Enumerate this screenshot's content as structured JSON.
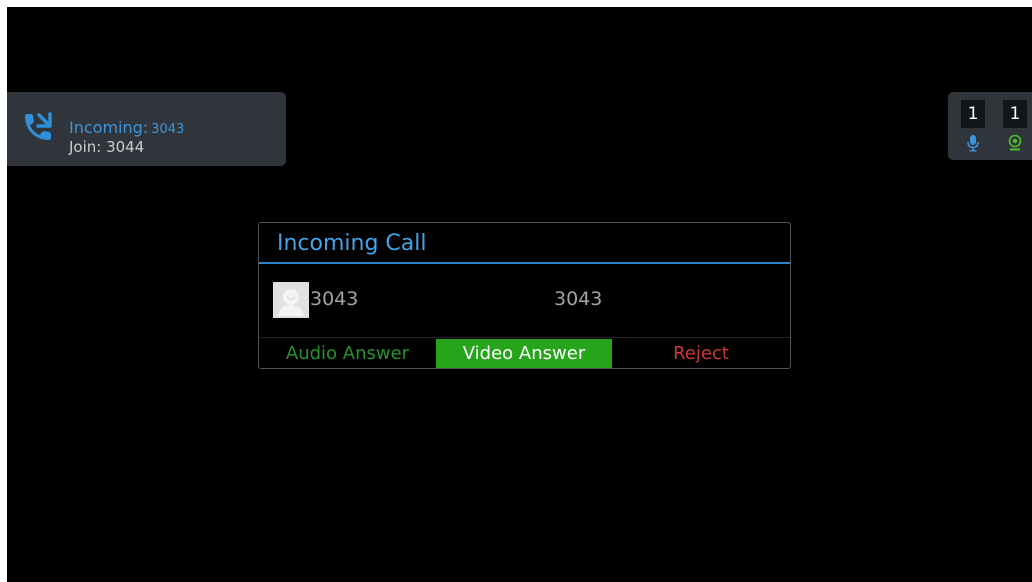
{
  "notification": {
    "icon": "incoming-call-icon",
    "incoming_label": "Incoming:",
    "incoming_number": "3043",
    "join_text": "Join: 3044"
  },
  "status": {
    "audio_count": "1",
    "video_count": "1",
    "audio_icon": "microphone-icon",
    "video_icon": "camera-icon"
  },
  "dialog": {
    "title": "Incoming Call",
    "caller_name": "3043",
    "caller_number": "3043",
    "avatar_icon": "contact-avatar-icon",
    "buttons": {
      "audio_answer": "Audio Answer",
      "video_answer": "Video Answer",
      "reject": "Reject"
    }
  },
  "colors": {
    "accent_blue": "#45a2e6",
    "answer_green": "#26a51b",
    "audio_green": "#27922c",
    "reject_red": "#c83a33",
    "panel": "#2f353b"
  }
}
